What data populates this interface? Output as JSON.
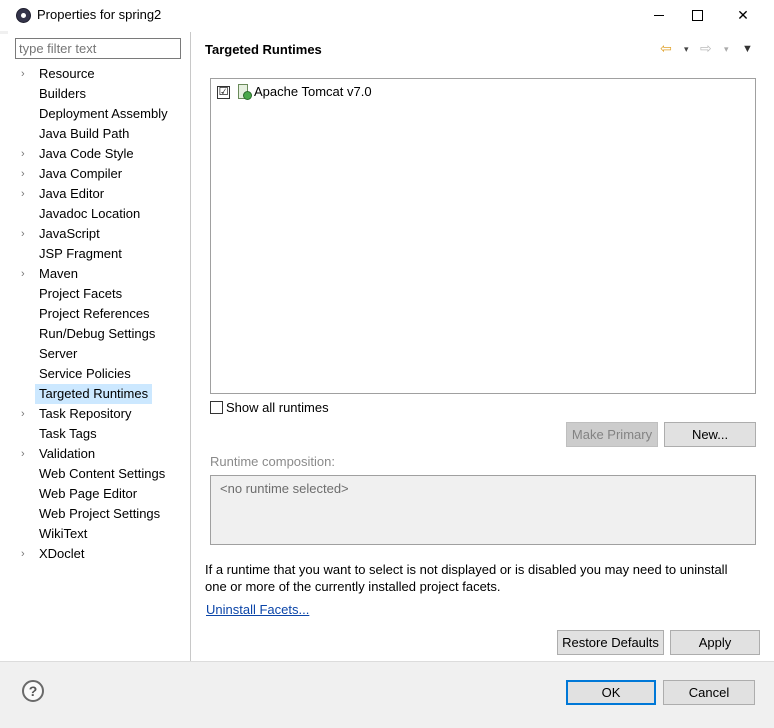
{
  "window": {
    "title": "Properties for spring2",
    "minimize_icon": "minimize-icon",
    "maximize_icon": "maximize-icon",
    "close_glyph": "✕"
  },
  "filter": {
    "placeholder": "type filter text"
  },
  "tree": [
    {
      "label": "Resource",
      "expandable": true
    },
    {
      "label": "Builders",
      "expandable": false
    },
    {
      "label": "Deployment Assembly",
      "expandable": false
    },
    {
      "label": "Java Build Path",
      "expandable": false
    },
    {
      "label": "Java Code Style",
      "expandable": true
    },
    {
      "label": "Java Compiler",
      "expandable": true
    },
    {
      "label": "Java Editor",
      "expandable": true
    },
    {
      "label": "Javadoc Location",
      "expandable": false
    },
    {
      "label": "JavaScript",
      "expandable": true
    },
    {
      "label": "JSP Fragment",
      "expandable": false
    },
    {
      "label": "Maven",
      "expandable": true
    },
    {
      "label": "Project Facets",
      "expandable": false
    },
    {
      "label": "Project References",
      "expandable": false
    },
    {
      "label": "Run/Debug Settings",
      "expandable": false
    },
    {
      "label": "Server",
      "expandable": false
    },
    {
      "label": "Service Policies",
      "expandable": false
    },
    {
      "label": "Targeted Runtimes",
      "expandable": false,
      "selected": true
    },
    {
      "label": "Task Repository",
      "expandable": true
    },
    {
      "label": "Task Tags",
      "expandable": false
    },
    {
      "label": "Validation",
      "expandable": true
    },
    {
      "label": "Web Content Settings",
      "expandable": false
    },
    {
      "label": "Web Page Editor",
      "expandable": false
    },
    {
      "label": "Web Project Settings",
      "expandable": false
    },
    {
      "label": "WikiText",
      "expandable": false
    },
    {
      "label": "XDoclet",
      "expandable": true
    }
  ],
  "page": {
    "title": "Targeted Runtimes",
    "nav": {
      "back_glyph": "⇦",
      "forward_glyph": "⇨",
      "dropdown_glyph": "▾",
      "menu_glyph": "▼"
    },
    "runtimes": [
      {
        "label": "Apache Tomcat v7.0",
        "checked": "☑"
      }
    ],
    "show_all_label": "Show all runtimes",
    "make_primary_label": "Make Primary",
    "new_label": "New...",
    "runtime_composition_label": "Runtime composition:",
    "runtime_composition_value": "<no runtime selected>",
    "info_line1": "If a runtime that you want to select is not displayed or is disabled you may need to uninstall",
    "info_line2": "one or more of the currently installed project facets.",
    "uninstall_link": "Uninstall Facets...",
    "restore_defaults_label": "Restore Defaults",
    "apply_label": "Apply"
  },
  "footer": {
    "help_glyph": "?",
    "ok_label": "OK",
    "cancel_label": "Cancel"
  },
  "colors": {
    "selection": "#cce8ff",
    "link": "#0b45a8",
    "default_button_border": "#0078d7"
  }
}
